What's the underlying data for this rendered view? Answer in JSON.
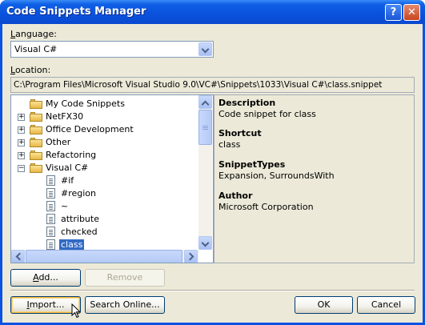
{
  "window": {
    "title": "Code Snippets Manager",
    "help_button": "?",
    "close_button": "✕"
  },
  "language": {
    "label_prefix": "",
    "label_accel": "L",
    "label_rest": "anguage:",
    "selected": "Visual C#"
  },
  "location": {
    "label_accel": "L",
    "label_rest": "ocation:",
    "value": "C:\\Program Files\\Microsoft Visual Studio 9.0\\VC#\\Snippets\\1033\\Visual C#\\class.snippet"
  },
  "tree": {
    "items": [
      {
        "label": "My Code Snippets",
        "type": "folder",
        "expander": ""
      },
      {
        "label": "NetFX30",
        "type": "folder",
        "expander": "+"
      },
      {
        "label": "Office Development",
        "type": "folder",
        "expander": "+"
      },
      {
        "label": "Other",
        "type": "folder",
        "expander": "+"
      },
      {
        "label": "Refactoring",
        "type": "folder",
        "expander": "+"
      },
      {
        "label": "Visual C#",
        "type": "folder-open",
        "expander": "−"
      },
      {
        "label": "#if",
        "type": "snippet"
      },
      {
        "label": "#region",
        "type": "snippet"
      },
      {
        "label": "~",
        "type": "snippet"
      },
      {
        "label": "attribute",
        "type": "snippet"
      },
      {
        "label": "checked",
        "type": "snippet"
      },
      {
        "label": "class",
        "type": "snippet",
        "selected": true
      }
    ]
  },
  "details": {
    "description": {
      "heading": "Description",
      "value": "Code snippet for class"
    },
    "shortcut": {
      "heading": "Shortcut",
      "value": "class"
    },
    "snippet_types": {
      "heading": "SnippetTypes",
      "value": "Expansion, SurroundsWith"
    },
    "author": {
      "heading": "Author",
      "value": "Microsoft Corporation"
    }
  },
  "buttons": {
    "add": {
      "accel": "A",
      "rest": "dd..."
    },
    "remove": "Remove",
    "import": {
      "accel": "I",
      "rest": "mport..."
    },
    "search_online": "Search Online...",
    "ok": "OK",
    "cancel": "Cancel"
  },
  "colors": {
    "titlebar": "#0a53e3",
    "dialog_bg": "#ece9d8",
    "selection": "#316ac5"
  }
}
